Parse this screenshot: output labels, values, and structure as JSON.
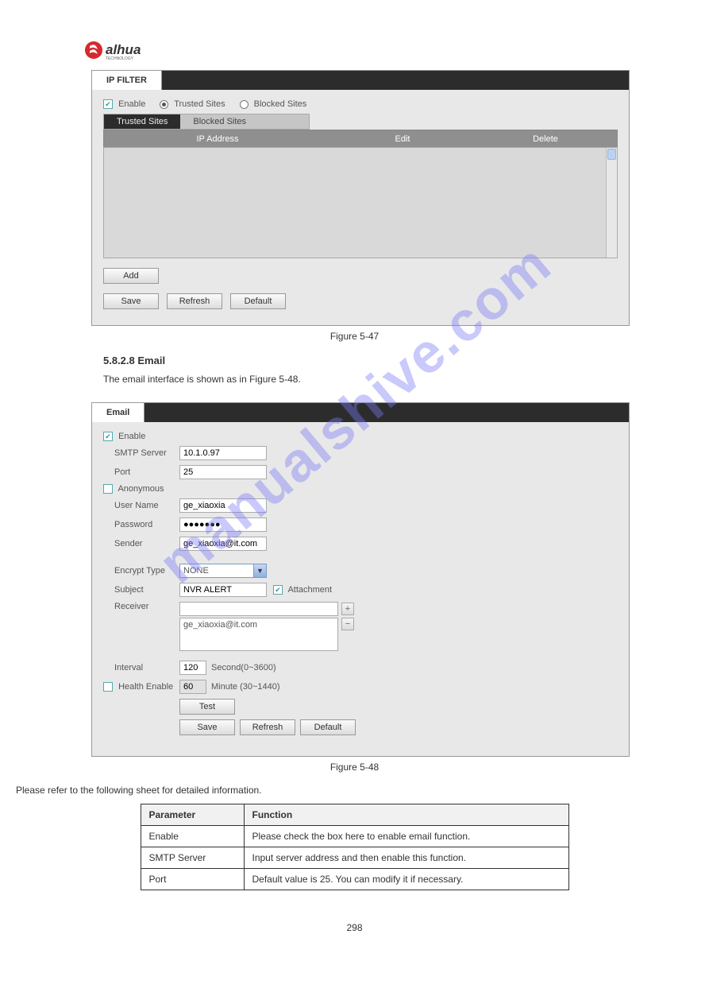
{
  "logo_sub": "TECHNOLOGY",
  "ipfilter": {
    "tab": "IP FILTER",
    "enable": "Enable",
    "trusted": "Trusted Sites",
    "blocked": "Blocked Sites",
    "subtab_trusted": "Trusted Sites",
    "subtab_blocked": "Blocked Sites",
    "hdr_ip": "IP Address",
    "hdr_edit": "Edit",
    "hdr_del": "Delete",
    "add": "Add",
    "save": "Save",
    "refresh": "Refresh",
    "default": "Default"
  },
  "fig_ip": "Figure 5-47",
  "email_section": {
    "heading": "5.8.2.8 Email",
    "p1": "The email interface is shown as in Figure 5-48."
  },
  "email": {
    "tab": "Email",
    "enable": "Enable",
    "smtp_lbl": "SMTP Server",
    "smtp_val": "10.1.0.97",
    "port_lbl": "Port",
    "port_val": "25",
    "anon": "Anonymous",
    "user_lbl": "User Name",
    "user_val": "ge_xiaoxia",
    "pwd_lbl": "Password",
    "pwd_val": "●●●●●●●",
    "sender_lbl": "Sender",
    "sender_val": "ge_xiaoxia@it.com",
    "enc_lbl": "Encrypt Type",
    "enc_val": "NONE",
    "subj_lbl": "Subject",
    "subj_val": "NVR ALERT",
    "att": "Attachment",
    "recv_lbl": "Receiver",
    "recv_val": "ge_xiaoxia@it.com",
    "int_lbl": "Interval",
    "int_val": "120",
    "int_unit": "Second(0~3600)",
    "health_lbl": "Health Enable",
    "health_val": "60",
    "health_unit": "Minute (30~1440)",
    "test": "Test",
    "save": "Save",
    "refresh": "Refresh",
    "default": "Default"
  },
  "fig_em": "Figure 5-48",
  "params_pre": "Please refer to the following sheet for detailed information.",
  "params": {
    "h1": "Parameter",
    "h2": "Function",
    "r1a": "Enable",
    "r1b": "Please check the box here to enable email function.",
    "r2a": "SMTP Server",
    "r2b": "Input server address and then enable this function.",
    "r3a": "Port",
    "r3b": "Default value is 25. You can modify it if necessary."
  },
  "pageno": "298",
  "wm": "manualshive.com"
}
